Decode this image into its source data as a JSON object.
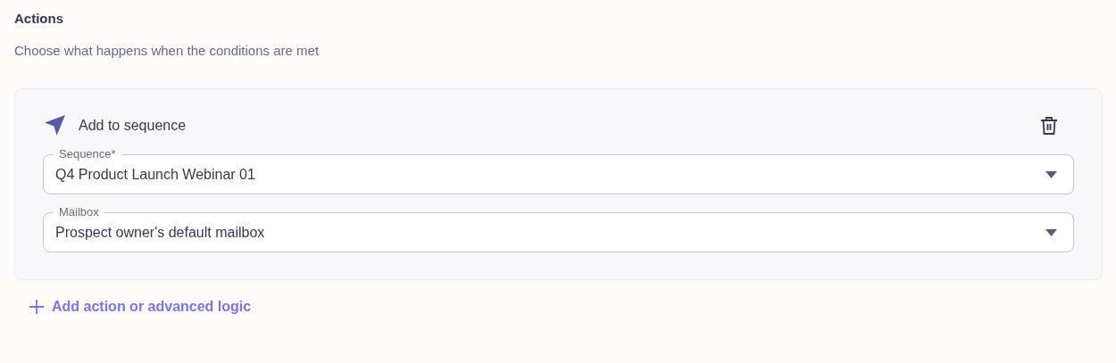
{
  "section": {
    "title": "Actions",
    "description": "Choose what happens when the conditions are met"
  },
  "action": {
    "title": "Add to sequence",
    "fields": [
      {
        "label": "Sequence*",
        "value": "Q4 Product Launch Webinar 01"
      },
      {
        "label": "Mailbox",
        "value": "Prospect owner's default mailbox"
      }
    ]
  },
  "add_link": "Add action or advanced logic"
}
